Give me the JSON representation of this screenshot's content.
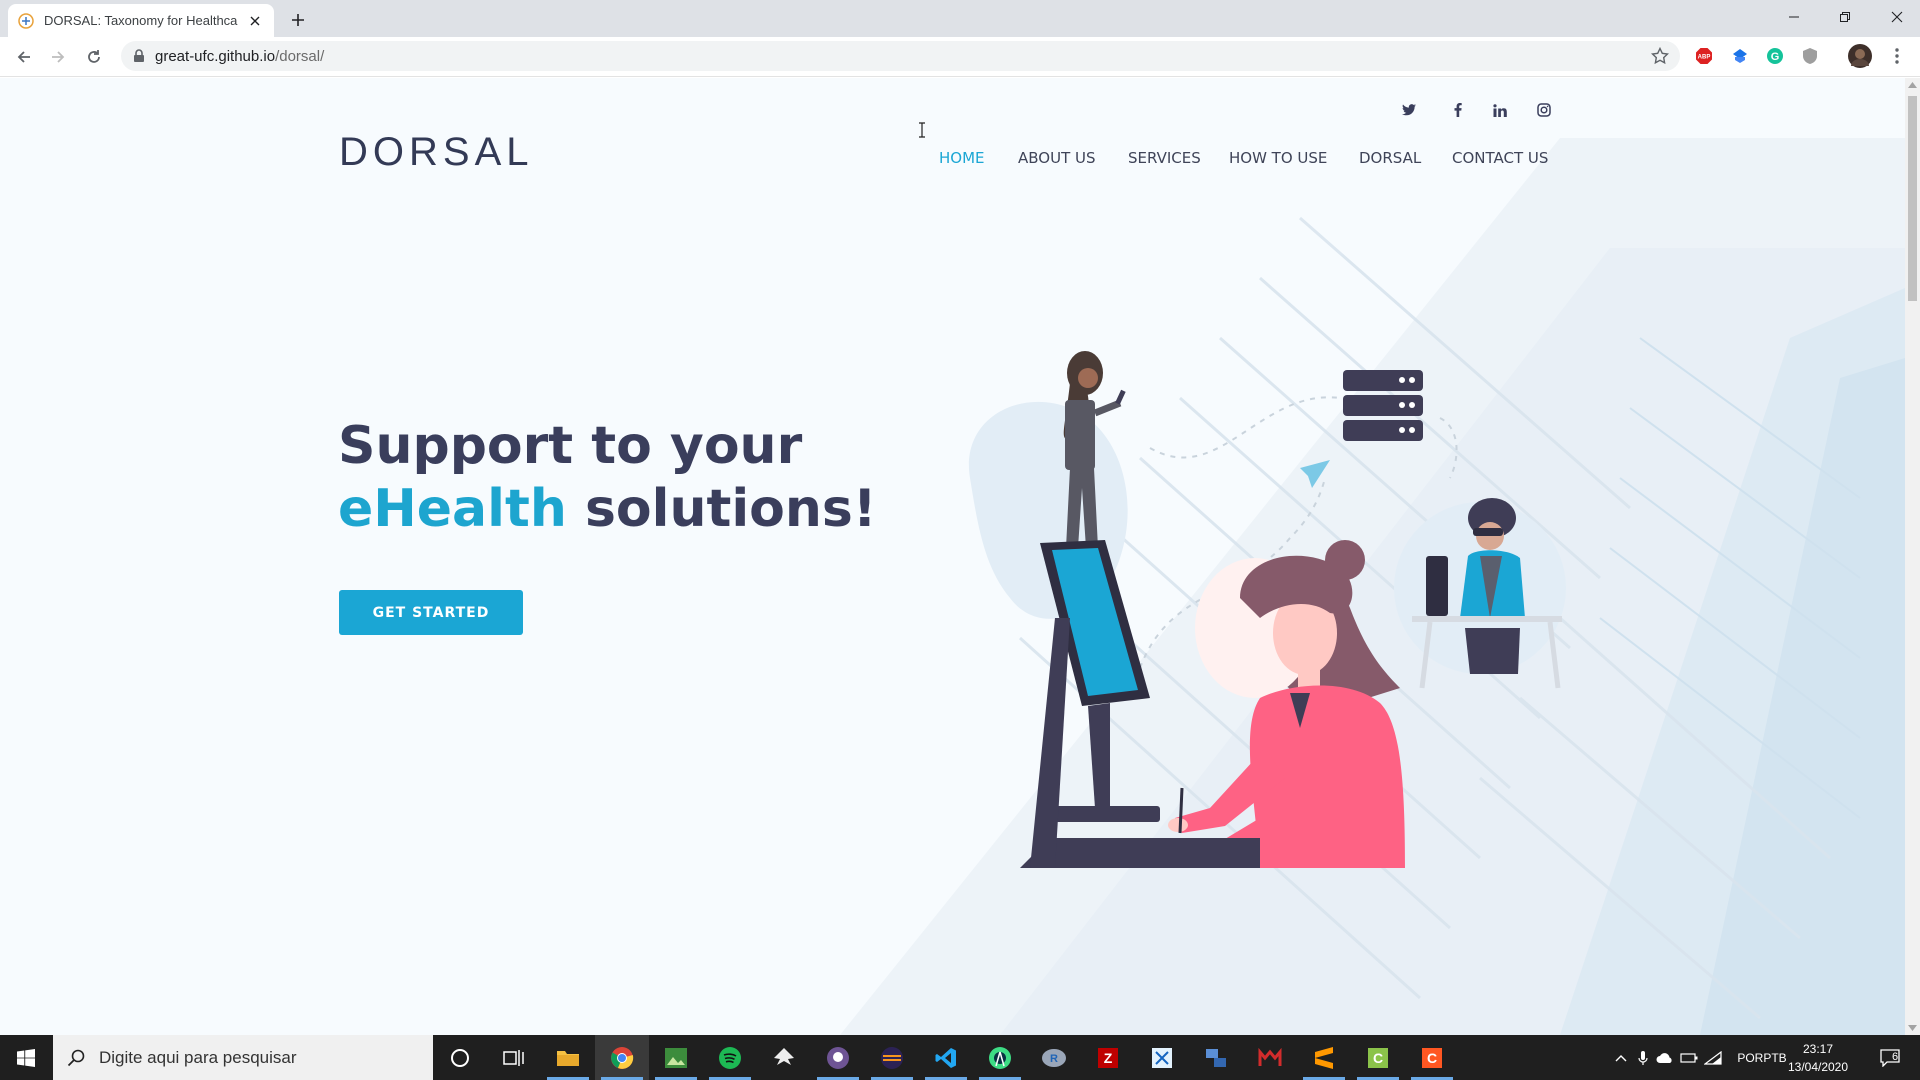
{
  "browser": {
    "tab_title": "DORSAL: Taxonomy for Healthca",
    "url_host": "great-ufc.github.io",
    "url_path": "/dorsal/"
  },
  "site": {
    "logo": "DORSAL",
    "nav": [
      {
        "label": "HOME",
        "active": true
      },
      {
        "label": "ABOUT US"
      },
      {
        "label": "SERVICES"
      },
      {
        "label": "HOW TO USE"
      },
      {
        "label": "DORSAL"
      },
      {
        "label": "CONTACT US"
      }
    ],
    "social": [
      "twitter-icon",
      "facebook-icon",
      "linkedin-icon",
      "instagram-icon"
    ],
    "hero": {
      "line1": "Support to your",
      "line2_accent": "eHealth",
      "line2_rest": " solutions!",
      "cta": "GET STARTED"
    }
  },
  "taskbar": {
    "search_placeholder": "Digite aqui para pesquisar",
    "lang_top": "POR",
    "lang_bottom": "PTB",
    "time": "23:17",
    "date": "13/04/2020",
    "notification_count": "6"
  },
  "colors": {
    "accent": "#1ba6d4",
    "heading": "#3a3e5c"
  }
}
